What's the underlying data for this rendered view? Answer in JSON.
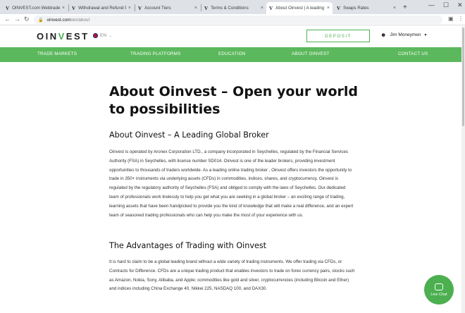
{
  "browser": {
    "tabs": [
      {
        "title": "OINVEST.com Webtrader"
      },
      {
        "title": "Withdrawal and Refund Po"
      },
      {
        "title": "Account Tiers"
      },
      {
        "title": "Terms & Conditions"
      },
      {
        "title": "About Oinvest | A leading"
      },
      {
        "title": "Swaps Rates"
      }
    ],
    "active_tab": 4,
    "favicon_glyph": "V",
    "close_glyph": "×",
    "new_tab_glyph": "+",
    "address": {
      "domain": "oinvest.com",
      "path": "/en/about"
    }
  },
  "site": {
    "logo": {
      "pre": "OIN",
      "mid": "V",
      "post": "EST"
    },
    "lang": "EN",
    "deposit_label": "DEPOSIT",
    "user_name": "Jim Moneymen",
    "nav": [
      "TRADE MARKETS",
      "TRADING PLATFORMS",
      "EDUCATION",
      "ABOUT OINVEST",
      "CONTACT US"
    ]
  },
  "page": {
    "title": "About Oinvest – Open your world to possibilities",
    "section1_heading": "About Oinvest – A Leading Global Broker",
    "section1_body": "Oinvest is operated by Aronex Corporation LTD., a company incorporated in Seychelles, regulated by the Financial Services Authority (FSA) in Seychelles, with license number SD014. Oinvest is one of the leader brokers, providing investment opportunities to thousands of traders worldwide.    As a leading online trading broker , Oinvest offers investors the opportunity to trade in 350+ instruments via underlying assets (CFDs) in commodities, indices, shares, and cryptocurrency. Oinvest is regulated by the regulatory authority of Seychelles (FSA) and obliged to comply with the laws of Seychelles. Our dedicated team of professionals work tirelessly to help you get what you are seeking in a global broker – an exciting range of trading, learning assets that have been handpicked to provide you the kind of knowledge that will make a real difference, and an expert team of seasoned trading professionals who can help you make the most of your experience with us.",
    "section2_heading": "The Advantages of Trading with Oinvest",
    "section2_body": "It is hard to claim to be a global leading brand without a wide variety of trading instruments. We offer trading via CFDs, or Contracts for Difference. CFDs are a unique trading product that enables investors to trade on forex currency pairs, stocks such as Amazon, Nokia, Sony, Alibaba, and Apple; commodities like gold and silver, cryptocurrencies (including Bitcoin and Ether) and indices including China Exchange 40, Nikkei 225, NASDAQ 100, and DAX30."
  },
  "live_chat_label": "Live Chat",
  "colors": {
    "brand_green": "#5cb85c",
    "tab_bar": "#dee1e6"
  }
}
